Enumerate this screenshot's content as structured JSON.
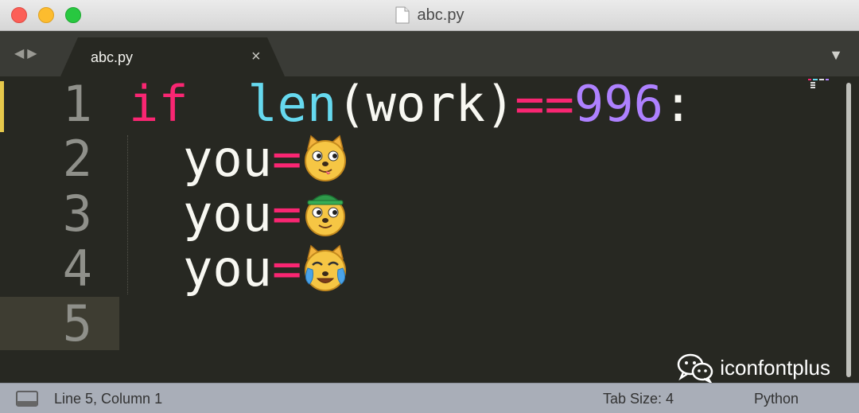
{
  "window": {
    "title": "abc.py"
  },
  "tabbar": {
    "active_tab": "abc.py",
    "close_glyph": "×"
  },
  "editor": {
    "line_numbers": [
      "1",
      "2",
      "3",
      "4",
      "5"
    ],
    "line1": {
      "kw": "if",
      "space": "  ",
      "fn": "len",
      "paren_open": "(",
      "arg": "work",
      "paren_close": ")",
      "op": "==",
      "num": "996",
      "colon": ":"
    },
    "line2": {
      "var": "you",
      "op": "=",
      "emoji": "doge-face-icon"
    },
    "line3": {
      "var": "you",
      "op": "=",
      "emoji": "doge-green-hat-icon"
    },
    "line4": {
      "var": "you",
      "op": "=",
      "emoji": "crying-laughing-doge-icon"
    }
  },
  "watermark": {
    "text": "iconfontplus",
    "icon": "wechat-icon"
  },
  "statusbar": {
    "position": "Line 5, Column 1",
    "tab_size": "Tab Size: 4",
    "syntax": "Python"
  },
  "colors": {
    "keyword": "#f92672",
    "function": "#66d9ef",
    "number": "#ae81ff",
    "background": "#272822",
    "gutter_highlight": "#3e3d32"
  }
}
